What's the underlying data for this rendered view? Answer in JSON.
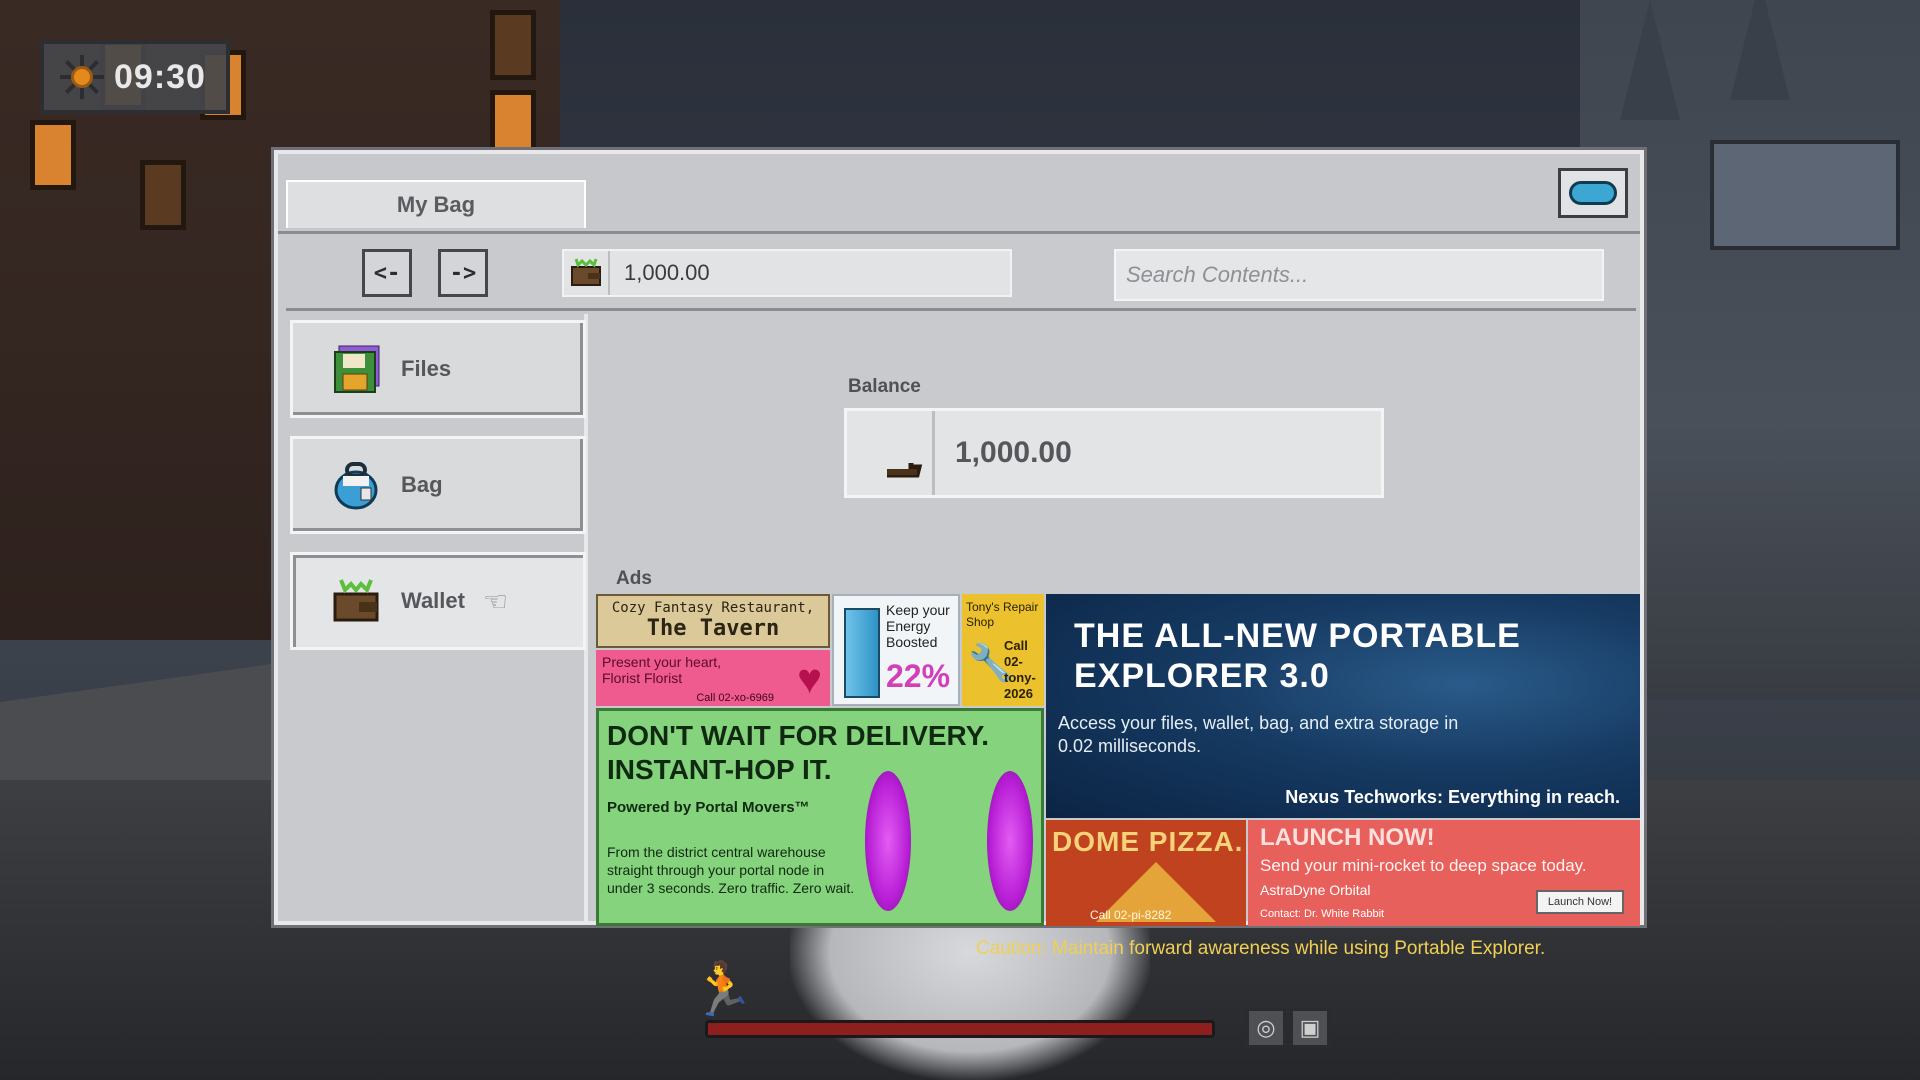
{
  "hud": {
    "time": "09:30",
    "caution": "Caution: Maintain forward awareness while using Portable Explorer.",
    "health_fraction": 1.0
  },
  "window": {
    "tab_title": "My Bag",
    "close_icon": "portal-close-icon"
  },
  "toolbar": {
    "back_label": "<-",
    "forward_label": "->",
    "wallet_value": "1,000.00",
    "search_placeholder": "Search Contents..."
  },
  "sidebar": {
    "items": [
      {
        "label": "Files",
        "icon": "floppy-disk-icon"
      },
      {
        "label": "Bag",
        "icon": "backpack-icon"
      },
      {
        "label": "Wallet",
        "icon": "wallet-icon",
        "selected": true
      }
    ]
  },
  "content": {
    "balance_label": "Balance",
    "balance_value": "1,000.00",
    "ads_label": "Ads"
  },
  "ads": {
    "tavern": {
      "line1": "Cozy Fantasy Restaurant,",
      "line2": "The Tavern"
    },
    "florist": {
      "line1": "Present your heart, Florist Florist",
      "call": "Call 02-xo-6969"
    },
    "energy": {
      "text": "Keep your Energy Boosted",
      "percent": "22%"
    },
    "tony": {
      "name": "Tony's Repair Shop",
      "call": "Call 02-tony-2026"
    },
    "explorer": {
      "headline": "THE ALL-NEW PORTABLE EXPLORER 3.0",
      "sub": "Access your files, wallet, bag, and extra storage in 0.02 milliseconds.",
      "footer": "Nexus Techworks: Everything in reach."
    },
    "portal": {
      "headline": "DON'T WAIT FOR DELIVERY. INSTANT-HOP IT.",
      "powered": "Powered by Portal Movers™",
      "body": "From the district central warehouse straight through your portal node in under 3 seconds. Zero traffic. Zero wait."
    },
    "pizza": {
      "name": "DOME PIZZA.",
      "call": "Call 02-pi-8282"
    },
    "launch": {
      "headline": "LAUNCH NOW!",
      "sub": "Send your mini-rocket to deep space today.",
      "company": "AstraDyne Orbital",
      "contact": "Contact: Dr. White Rabbit",
      "button": "Launch Now!"
    }
  },
  "colors": {
    "caution": "#f0cf55",
    "explorer_ad_bg": "#163a62",
    "portal_ad_bg": "#86d37e",
    "launch_ad_bg": "#e8605b",
    "pizza_ad_bg": "#c1421e",
    "health": "#8e1f1f"
  }
}
